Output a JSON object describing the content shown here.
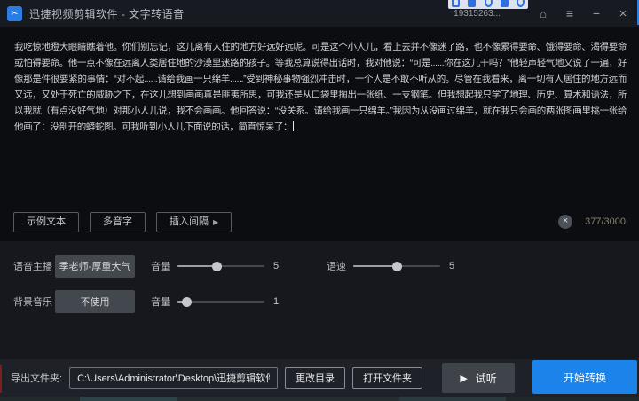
{
  "titlebar": {
    "title": "迅捷视频剪辑软件 - 文字转语音",
    "user_id": "19315263...",
    "icons": {
      "home": "⌂",
      "menu": "≡",
      "minimize": "−",
      "close": "×"
    }
  },
  "editor": {
    "text": "我吃惊地瞪大眼睛瞧着他。你们别忘记，这儿离有人住的地方好远好远呢。可是这个小人儿，看上去并不像迷了路，也不像累得要命、饿得要命、渴得要命或怕得要命。他一点不像在远离人类居住地的沙漠里迷路的孩子。等我总算说得出话时，我对他说：“可是......你在这儿干吗？”他轻声轻气地又说了一遍，好像那是件很要紧的事情：“对不起......请给我画一只绵羊......”受到神秘事物强烈冲击时，一个人是不敢不听从的。尽管在我看来，离一切有人居住的地方远而又远，又处于死亡的威胁之下，在这儿想到画画真是匪夷所思，可我还是从口袋里掏出一张纸、一支钢笔。但我想起我只学了地理、历史、算术和语法，所以我就（有点没好气地）对那小人儿说，我不会画画。他回答说：“没关系。请给我画一只绵羊。”我因为从没画过绵羊，就在我只会画的两张图画里挑一张给他画了：没剖开的蟒蛇图。可我听到小人儿下面说的话，简直惊呆了：",
    "toolbar": {
      "sample_text": "示例文本",
      "polyphone": "多音字",
      "insert_interval": "插入间隔",
      "interval_arrow": "▶",
      "clear_icon": "×",
      "char_count": "377/3000"
    }
  },
  "voice": {
    "anchor_label": "语音主播",
    "anchor_value": "季老师-厚重大气",
    "volume_label": "音量",
    "volume_value": "5",
    "speed_label": "语速",
    "speed_value": "5"
  },
  "bgm": {
    "label": "背景音乐",
    "value": "不使用",
    "volume_label": "音量",
    "volume_value": "1"
  },
  "footer": {
    "export_label": "导出文件夹:",
    "path": "C:\\Users\\Administrator\\Desktop\\迅捷剪辑软件",
    "change_dir": "更改目录",
    "open_folder": "打开文件夹",
    "preview": "试听",
    "play_icon": "▶",
    "start": "开始转换"
  },
  "colors": {
    "accent_blue": "#1c83ea",
    "titlebar_bg": "#171a20",
    "editor_bg": "#0b0d10",
    "panel_bg": "#16181d",
    "footer_bg": "#1e2127"
  }
}
